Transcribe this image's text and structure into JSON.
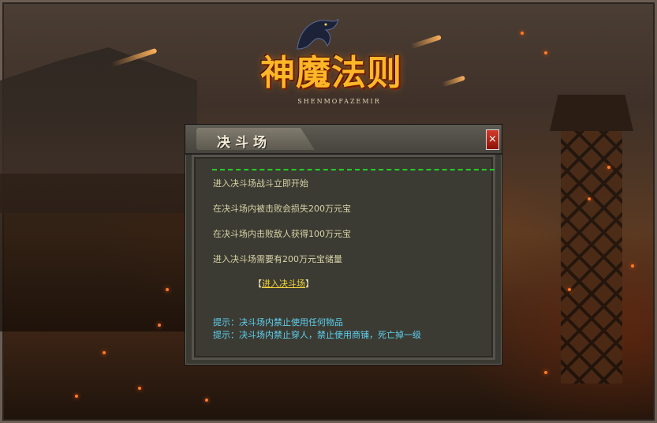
{
  "logo": {
    "title": "神魔法则",
    "subtitle": "SHENMOFAZEMIR"
  },
  "dialog": {
    "title": "决斗场",
    "close_label": "×",
    "lines": [
      "进入决斗场战斗立即开始",
      "在决斗场内被击败会损失200万元宝",
      "在决斗场内击败敌人获得100万元宝",
      "进入决斗场需要有200万元宝储量"
    ],
    "link": {
      "bracket_open": "【",
      "label": "进入决斗场",
      "bracket_close": "】"
    },
    "tips": [
      "提示：决斗场内禁止使用任何物品",
      "提示：决斗场内禁止穿人，禁止使用商铺，死亡掉一级"
    ]
  },
  "colors": {
    "info_text": "#d9d3a8",
    "link": "#f5d43a",
    "tip": "#5fd0f0",
    "separator": "#22d022",
    "close_button": "#c0281a"
  }
}
